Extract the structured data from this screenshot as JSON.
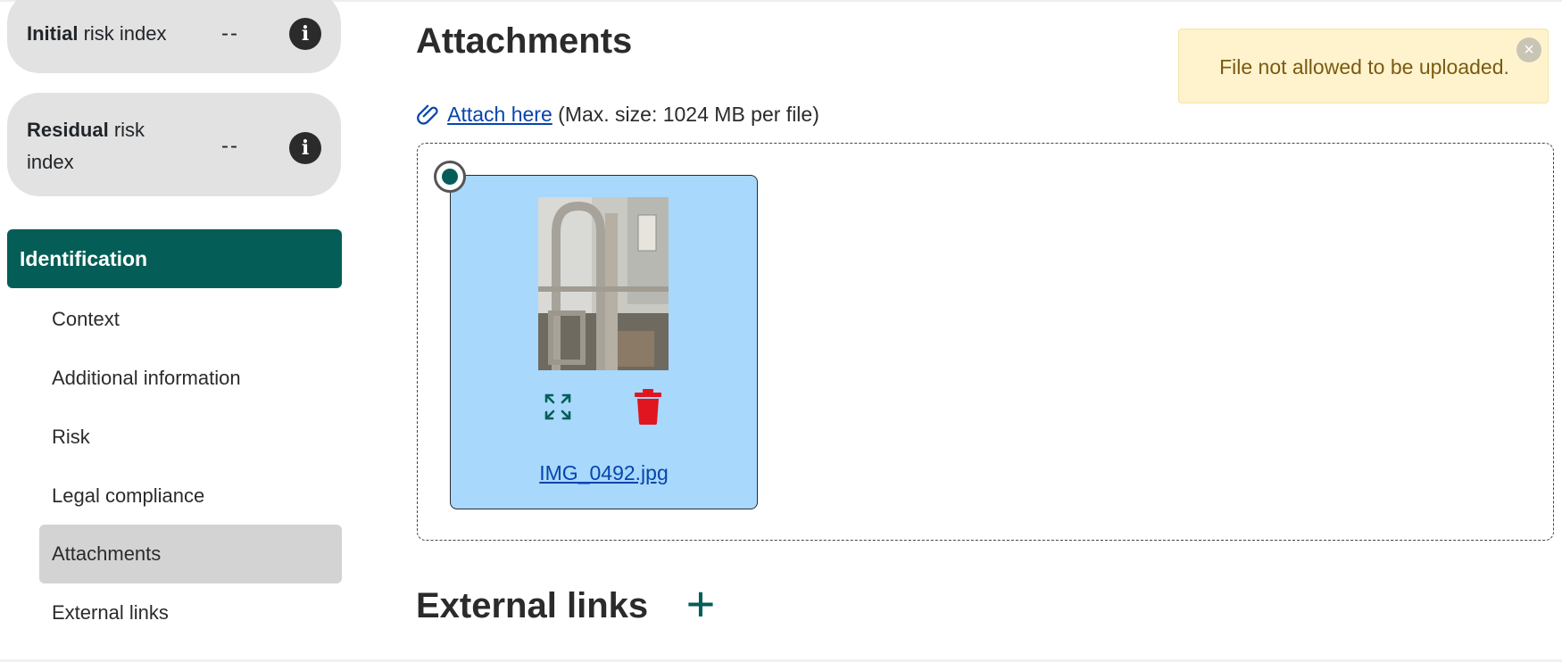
{
  "sidebar": {
    "initial_risk": {
      "label_bold": "Initial",
      "label_rest": " risk index",
      "value": "--",
      "info_glyph": "i"
    },
    "residual_risk": {
      "label_bold": "Residual",
      "label_rest": " risk index",
      "value": "--",
      "info_glyph": "i"
    },
    "section": "Identification",
    "items": [
      {
        "label": "Context"
      },
      {
        "label": "Additional information"
      },
      {
        "label": "Risk"
      },
      {
        "label": "Legal compliance"
      },
      {
        "label": "Attachments",
        "active": true
      },
      {
        "label": "External links"
      }
    ]
  },
  "main": {
    "attachments_title": "Attachments",
    "attach_link": "Attach here",
    "attach_note": " (Max. size: 1024 MB per file)",
    "files": [
      {
        "name": "IMG_0492.jpg"
      }
    ],
    "external_links_title": "External links",
    "add_icon": "+"
  },
  "toast": {
    "message": "File not allowed to be uploaded.",
    "close_glyph": "×"
  },
  "colors": {
    "primary": "#045e57",
    "card_bg": "#a8d8fc",
    "toast_bg": "#fff3cd",
    "delete": "#e0151f",
    "link": "#0645ad"
  }
}
